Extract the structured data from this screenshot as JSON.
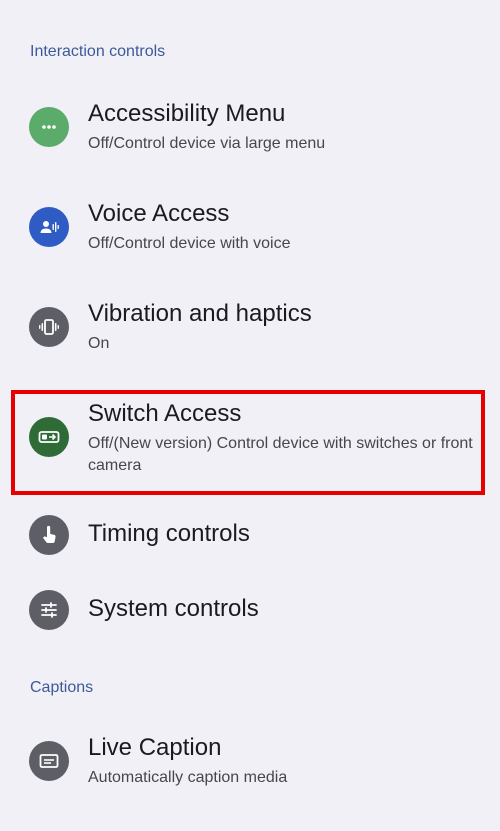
{
  "sections": {
    "interaction": {
      "header": "Interaction controls"
    },
    "captions": {
      "header": "Captions"
    }
  },
  "items": {
    "accessibility_menu": {
      "title": "Accessibility Menu",
      "subtitle": "Off/Control device via large menu",
      "icon": "more-horiz-icon",
      "color": "#5bab6b"
    },
    "voice_access": {
      "title": "Voice Access",
      "subtitle": "Off/Control device with voice",
      "icon": "voice-access-icon",
      "color": "#2f5bc4"
    },
    "vibration": {
      "title": "Vibration and haptics",
      "subtitle": "On",
      "icon": "vibration-icon",
      "color": "#5d5e66"
    },
    "switch_access": {
      "title": "Switch Access",
      "subtitle": "Off/(New version) Control device with switches or front camera",
      "icon": "switch-access-icon",
      "color": "#2e6b36"
    },
    "timing_controls": {
      "title": "Timing controls",
      "icon": "touch-icon",
      "color": "#5d5e66"
    },
    "system_controls": {
      "title": "System controls",
      "icon": "tune-icon",
      "color": "#5d5e66"
    },
    "live_caption": {
      "title": "Live Caption",
      "subtitle": "Automatically caption media",
      "icon": "closed-caption-icon",
      "color": "#5d5e66"
    }
  },
  "highlight_color": "#e80000"
}
